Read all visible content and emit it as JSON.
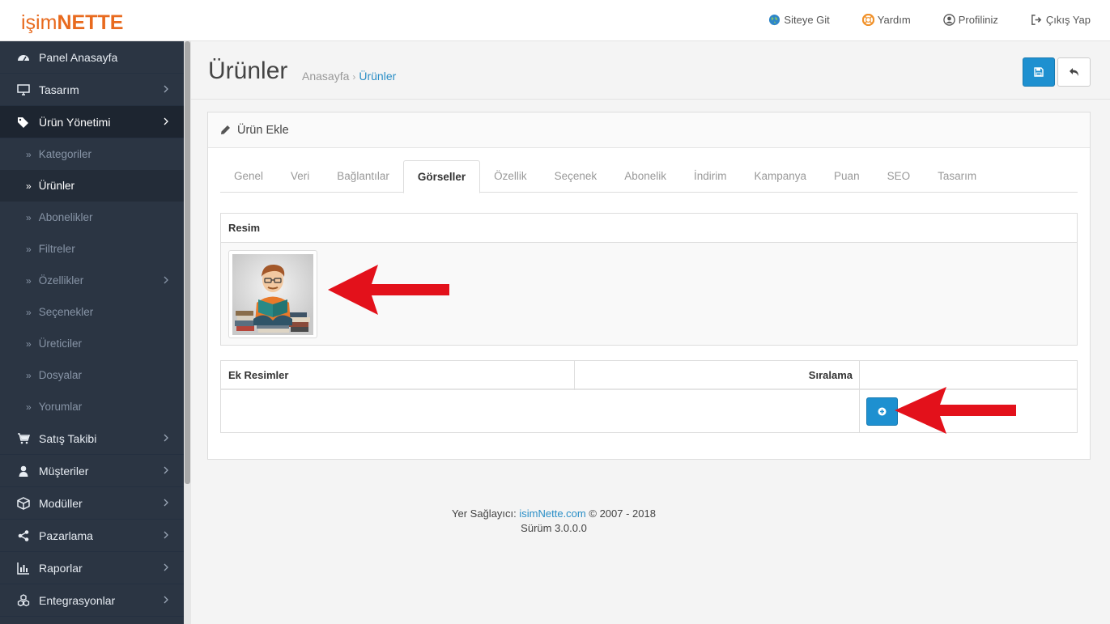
{
  "header": {
    "logo_part1": "işim",
    "logo_part2": "NETTE",
    "nav": [
      {
        "label": "Siteye Git",
        "icon": "globe-icon"
      },
      {
        "label": "Yardım",
        "icon": "lifebuoy-icon"
      },
      {
        "label": "Profiliniz",
        "icon": "user-circle-icon"
      },
      {
        "label": "Çıkış Yap",
        "icon": "sign-out-icon"
      }
    ]
  },
  "sidebar": {
    "items": [
      {
        "label": "Panel Anasayfa",
        "icon": "dashboard-icon"
      },
      {
        "label": "Tasarım",
        "icon": "desktop-icon"
      },
      {
        "label": "Ürün Yönetimi",
        "icon": "tags-icon"
      },
      {
        "label": "Satış Takibi",
        "icon": "cart-icon"
      },
      {
        "label": "Müşteriler",
        "icon": "user-icon"
      },
      {
        "label": "Modüller",
        "icon": "cube-icon"
      },
      {
        "label": "Pazarlama",
        "icon": "share-icon"
      },
      {
        "label": "Raporlar",
        "icon": "bar-chart-icon"
      },
      {
        "label": "Entegrasyonlar",
        "icon": "cubes-icon"
      }
    ],
    "subitems": [
      {
        "label": "Kategoriler"
      },
      {
        "label": "Ürünler"
      },
      {
        "label": "Abonelikler"
      },
      {
        "label": "Filtreler"
      },
      {
        "label": "Özellikler"
      },
      {
        "label": "Seçenekler"
      },
      {
        "label": "Üreticiler"
      },
      {
        "label": "Dosyalar"
      },
      {
        "label": "Yorumlar"
      }
    ]
  },
  "page": {
    "title": "Ürünler",
    "breadcrumb": [
      "Anasayfa",
      "Ürünler"
    ],
    "breadcrumb_sep": "›"
  },
  "panel": {
    "title": "Ürün Ekle",
    "tabs": [
      "Genel",
      "Veri",
      "Bağlantılar",
      "Görseller",
      "Özellik",
      "Seçenek",
      "Abonelik",
      "İndirim",
      "Kampanya",
      "Puan",
      "SEO",
      "Tasarım"
    ],
    "active_tab": "Görseller",
    "image_table": {
      "header": "Resim"
    },
    "extra_table": {
      "col1": "Ek Resimler",
      "col2": "Sıralama"
    }
  },
  "footer": {
    "prefix": "Yer Sağlayıcı:",
    "link": "isimNette.com",
    "suffix": "© 2007 - 2018",
    "version": "Sürüm 3.0.0.0"
  },
  "colors": {
    "brand": "#e86a1e",
    "primary": "#1e90d0",
    "sidebar": "#2b3543",
    "annotation_arrow": "#e3111b"
  }
}
